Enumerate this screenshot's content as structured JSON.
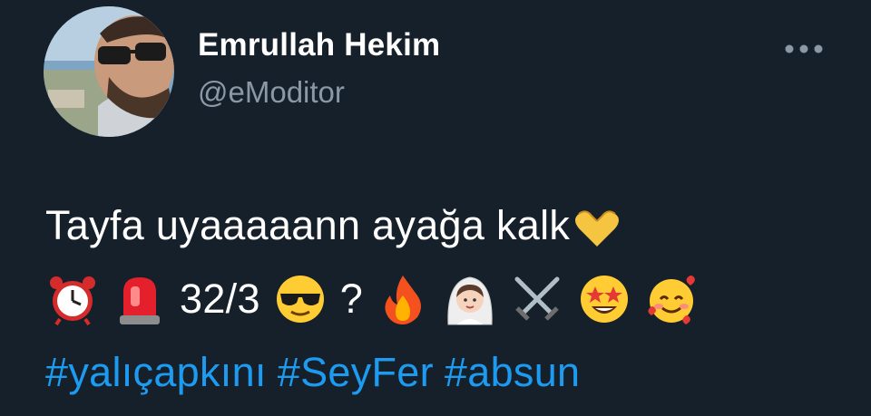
{
  "author": {
    "display_name": "Emrullah Hekim",
    "handle": "@eModitor"
  },
  "more_icon": "more-horizontal-icon",
  "tweet": {
    "line1_text": "Tayfa uyaaaaann ayağa kalk",
    "line1_emoji": "heart-hands-emoji",
    "line2": [
      {
        "type": "emoji",
        "icon": "alarm-clock-emoji"
      },
      {
        "type": "emoji",
        "icon": "police-light-emoji"
      },
      {
        "type": "text",
        "text": "32/3"
      },
      {
        "type": "emoji",
        "icon": "sunglasses-face-emoji"
      },
      {
        "type": "text",
        "text": "?"
      },
      {
        "type": "emoji",
        "icon": "fire-emoji"
      },
      {
        "type": "emoji",
        "icon": "bride-with-veil-emoji"
      },
      {
        "type": "emoji",
        "icon": "crossed-swords-emoji"
      },
      {
        "type": "emoji",
        "icon": "star-struck-emoji"
      },
      {
        "type": "emoji",
        "icon": "smiling-face-with-hearts-emoji"
      }
    ],
    "hashtags": [
      "#yalıçapkını",
      "#SeyFer",
      "#absun"
    ]
  },
  "colors": {
    "background": "#15202b",
    "text": "#ffffff",
    "secondary_text": "#8b98a5",
    "link": "#1d9bf0"
  }
}
